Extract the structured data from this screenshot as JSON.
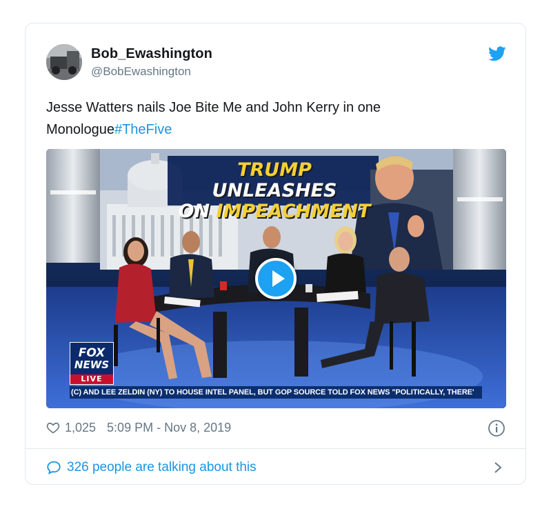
{
  "author": {
    "name": "Bob_Ewashington",
    "handle": "@BobEwashington"
  },
  "tweet": {
    "text": "Jesse Watters nails Joe Bite Me and John Kerry in one Monologue",
    "hashtag": "#TheFive"
  },
  "media": {
    "headline_line1_yellow": "TRUMP",
    "headline_line1_white": " UNLEASHES",
    "headline_line2_white": "ON ",
    "headline_line2_yellow": "IMPEACHMENT",
    "logo_line1": "FOX",
    "logo_line2": "NEWS",
    "logo_live": "LIVE",
    "ticker": "(C) AND LEE ZELDIN (NY) TO HOUSE INTEL PANEL, BUT GOP SOURCE TOLD FOX NEWS \"POLITICALLY, THERE'"
  },
  "footer": {
    "likes": "1,025",
    "timestamp": "5:09 PM - Nov 8, 2019",
    "talking": "326 people are talking about this"
  },
  "icons": {
    "brand": "twitter-bird-icon",
    "like": "heart-icon",
    "info": "info-icon",
    "talk": "speech-bubble-icon",
    "more": "chevron-right-icon"
  },
  "colors": {
    "brand_blue": "#1da1f2",
    "link_blue": "#1b95e0",
    "secondary_text": "#657786",
    "border": "#e1e8ed"
  }
}
